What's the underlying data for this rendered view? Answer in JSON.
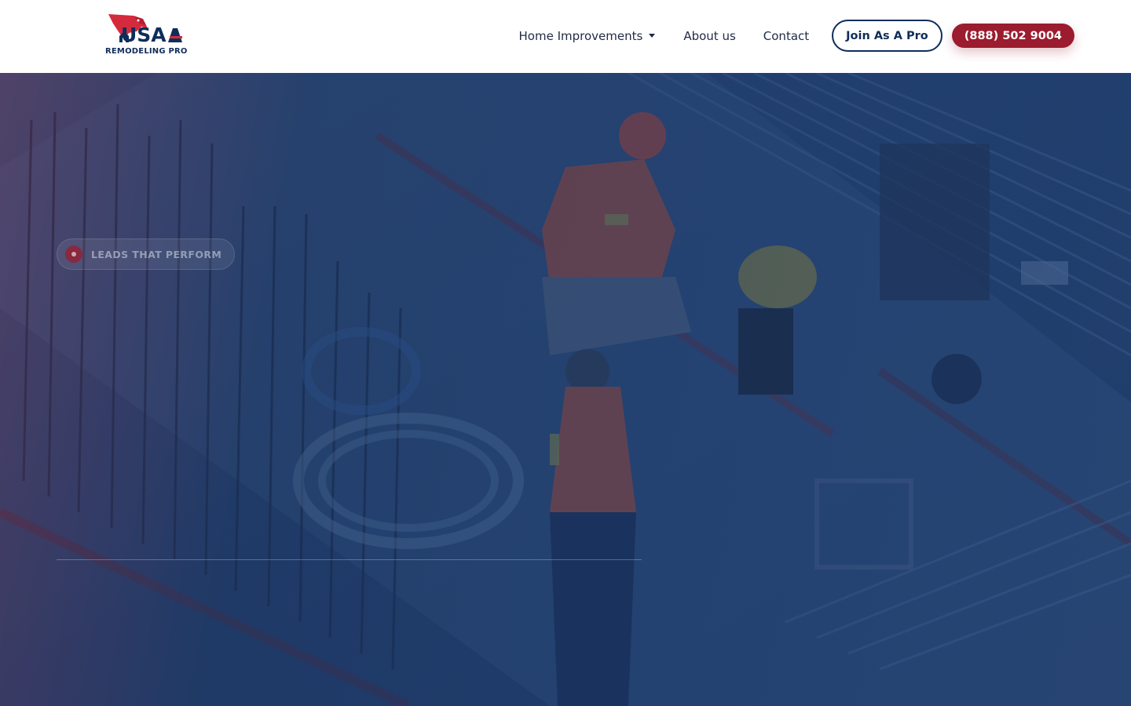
{
  "brand": {
    "name": "USA",
    "tagline": "REMODELING PRO",
    "colors": {
      "navy": "#0f2d5a",
      "red": "#9b1c2e",
      "accent_red": "#d42a3c"
    }
  },
  "nav": {
    "items": [
      {
        "label": "Home Improvements",
        "has_dropdown": true
      },
      {
        "label": "About us"
      },
      {
        "label": "Contact"
      }
    ],
    "join_button": "Join As A Pro",
    "phone_button": "(888) 502 9004"
  },
  "hero": {
    "badge": "LEADS THAT PERFORM",
    "background_image": "construction-workers-rebar-site"
  }
}
